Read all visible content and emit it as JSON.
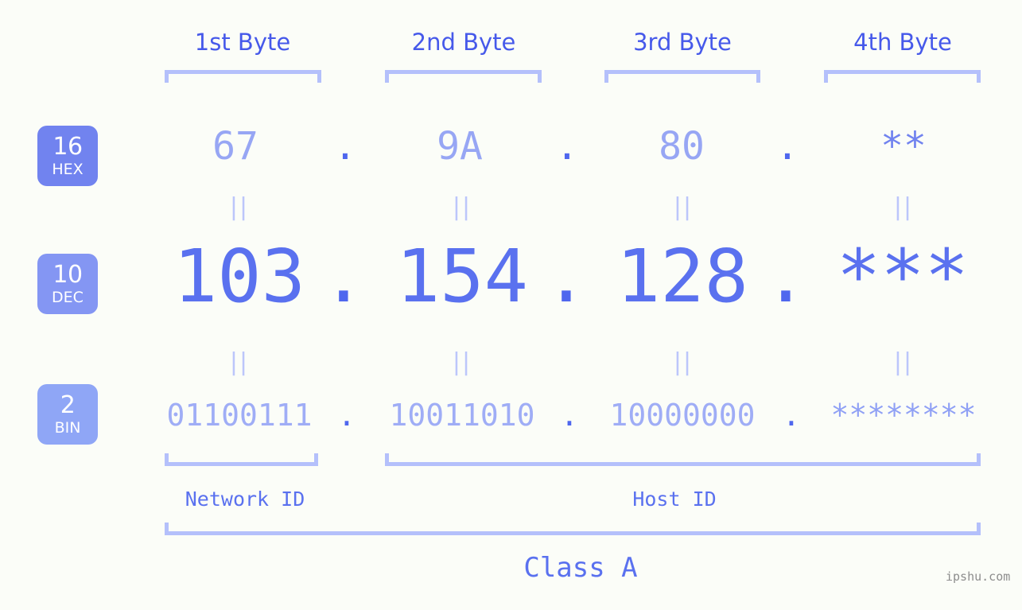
{
  "background_color": "#fbfdf8",
  "accent_color": "#5a71ef",
  "bracket_color": "#b4c0fb",
  "byte_headers": [
    {
      "label": "1st Byte"
    },
    {
      "label": "2nd Byte"
    },
    {
      "label": "3rd Byte"
    },
    {
      "label": "4th Byte"
    }
  ],
  "bases": [
    {
      "num": "16",
      "name": "HEX",
      "color": "#7183ef"
    },
    {
      "num": "10",
      "name": "DEC",
      "color": "#8496f3"
    },
    {
      "num": "2",
      "name": "BIN",
      "color": "#8fa6f6"
    }
  ],
  "rows": {
    "hex": {
      "base_num": "16",
      "base_name": "HEX",
      "values": [
        "67",
        "9A",
        "80",
        "**"
      ],
      "separator": "."
    },
    "dec": {
      "base_num": "10",
      "base_name": "DEC",
      "values": [
        "103",
        "154",
        "128",
        "***"
      ],
      "separator": "."
    },
    "bin": {
      "base_num": "2",
      "base_name": "BIN",
      "values": [
        "01100111",
        "10011010",
        "10000000",
        "********"
      ],
      "separator": "."
    }
  },
  "equals_symbol": "||",
  "sections": [
    {
      "label": "Network ID"
    },
    {
      "label": "Host ID"
    }
  ],
  "class": {
    "label": "Class A"
  },
  "watermark": {
    "text": "ipshu.com"
  }
}
